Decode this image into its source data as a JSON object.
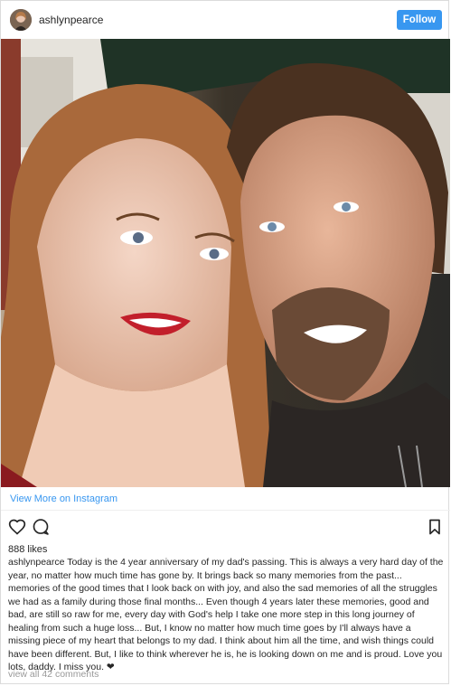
{
  "post": {
    "username": "ashlynpearce",
    "follow_label": "Follow",
    "view_more_label": "View More on Instagram",
    "likes": "888 likes",
    "caption_user": "ashlynpearce",
    "caption_text": "Today is the 4 year anniversary of my dad's passing. This is always a very hard day of the year, no matter how much time has gone by. It brings back so many memories from the past... memories of the good times that I look back on with joy, and also the sad memories of all the struggles we had as a family during those final months... Even though 4 years later these memories, good and bad, are still so raw for me, every day with God's help I take one more step in this long journey of healing from such a huge loss... But, I know no matter how much time goes by I'll always have a missing piece of my heart that belongs to my dad. I think about him all the time, and wish things could have been different. But, I like to think wherever he is, he is looking down on me and is proud. Love you lots, daddy. I miss you. ❤",
    "comments_link": "view all 42 comments"
  },
  "icons": {
    "like": "heart-icon",
    "comment": "comment-icon",
    "save": "bookmark-icon"
  },
  "colors": {
    "accent": "#3897f0",
    "text": "#262626",
    "muted": "#999999"
  }
}
